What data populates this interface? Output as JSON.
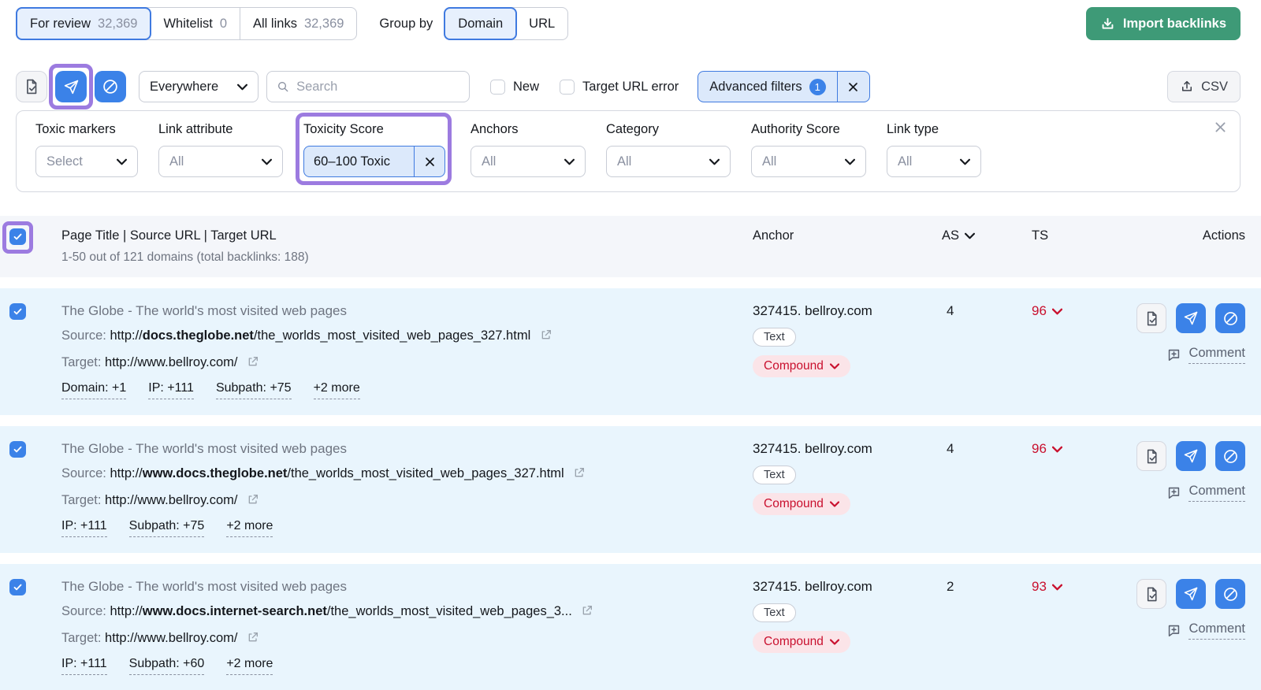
{
  "top_bar": {
    "tabs": [
      {
        "label": "For review",
        "count": "32,369"
      },
      {
        "label": "Whitelist",
        "count": "0"
      },
      {
        "label": "All links",
        "count": "32,369"
      }
    ],
    "group_by_label": "Group by",
    "group_by_options": [
      {
        "label": "Domain"
      },
      {
        "label": "URL"
      }
    ],
    "import_button_label": "Import backlinks"
  },
  "toolbar": {
    "everywhere_value": "Everywhere",
    "search_placeholder": "Search",
    "new_checkbox_label": "New",
    "target_url_error_label": "Target URL error",
    "advanced_filters_label": "Advanced filters",
    "advanced_filters_badge": "1",
    "csv_label": "CSV"
  },
  "filter_panel": {
    "filters": [
      {
        "label": "Toxic markers",
        "value": "Select"
      },
      {
        "label": "Link attribute",
        "value": "All"
      },
      {
        "label": "Toxicity Score",
        "value": "60–100 Toxic"
      },
      {
        "label": "Anchors",
        "value": "All"
      },
      {
        "label": "Category",
        "value": "All"
      },
      {
        "label": "Authority Score",
        "value": "All"
      },
      {
        "label": "Link type",
        "value": "All"
      }
    ]
  },
  "table": {
    "header": {
      "title_column": "Page Title | Source URL | Target URL",
      "subtitle": "1-50 out of 121 domains (total backlinks: 188)",
      "anchor_column": "Anchor",
      "as_column": "AS",
      "ts_column": "TS",
      "actions_column": "Actions"
    },
    "rows": [
      {
        "title": "The Globe - The world's most visited web pages",
        "source_label": "Source:",
        "source_scheme": "http://",
        "source_domain": "docs.theglobe.net",
        "source_path": "/the_worlds_most_visited_web_pages_327.html",
        "target_label": "Target:",
        "target_url": "http://www.bellroy.com/",
        "tags": [
          "Domain: +1",
          "IP: +111",
          "Subpath: +75",
          "+2 more"
        ],
        "anchor": "327415. bellroy.com",
        "anchor_type": "Text",
        "match_badge": "Compound",
        "authority_score": "4",
        "toxicity_score": "96",
        "comment_label": "Comment"
      },
      {
        "title": "The Globe - The world's most visited web pages",
        "source_label": "Source:",
        "source_scheme": "http://",
        "source_domain": "www.docs.theglobe.net",
        "source_path": "/the_worlds_most_visited_web_pages_327.html",
        "target_label": "Target:",
        "target_url": "http://www.bellroy.com/",
        "tags": [
          "IP: +111",
          "Subpath: +75",
          "+2 more"
        ],
        "anchor": "327415. bellroy.com",
        "anchor_type": "Text",
        "match_badge": "Compound",
        "authority_score": "4",
        "toxicity_score": "96",
        "comment_label": "Comment"
      },
      {
        "title": "The Globe - The world's most visited web pages",
        "source_label": "Source:",
        "source_scheme": "http://",
        "source_domain": "www.docs.internet-search.net",
        "source_path": "/the_worlds_most_visited_web_pages_3...",
        "target_label": "Target:",
        "target_url": "http://www.bellroy.com/",
        "tags": [
          "IP: +111",
          "Subpath: +60",
          "+2 more"
        ],
        "anchor": "327415. bellroy.com",
        "anchor_type": "Text",
        "match_badge": "Compound",
        "authority_score": "2",
        "toxicity_score": "93",
        "comment_label": "Comment"
      }
    ]
  },
  "colors": {
    "accent_blue": "#3b82e8",
    "highlight_purple": "#9c7be0",
    "toxic_red": "#c9102e",
    "import_green": "#3e9a77",
    "selected_row_blue": "#e9f5fd"
  }
}
